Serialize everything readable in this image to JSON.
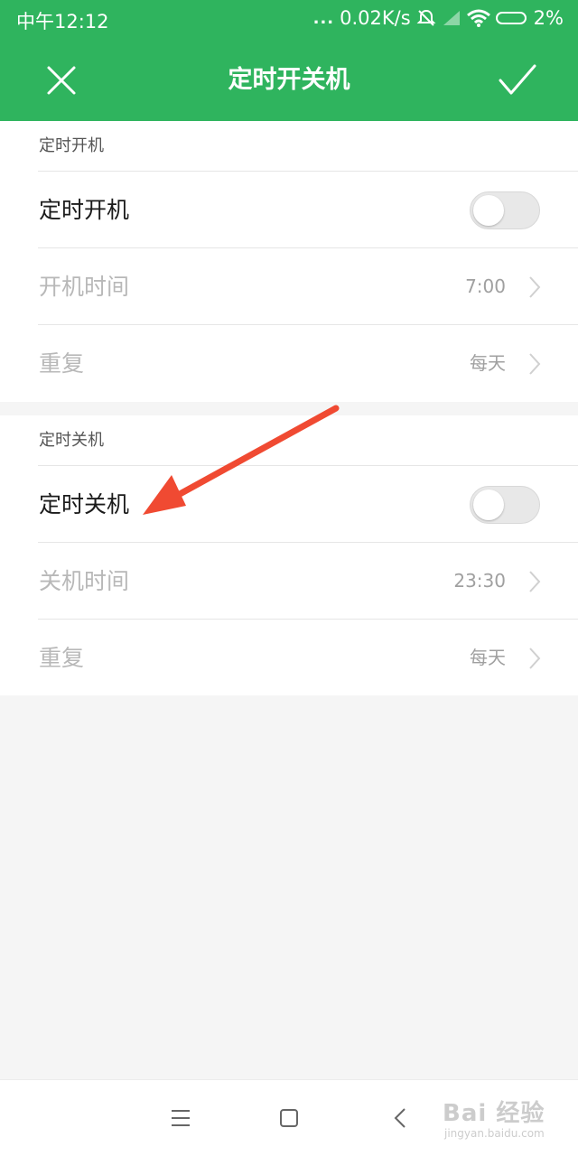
{
  "status_bar": {
    "time": "中午12:12",
    "dots": "...",
    "net_speed": "0.02K/s",
    "battery": "2%"
  },
  "header": {
    "title": "定时开关机",
    "icons": {
      "close": "close-icon",
      "confirm": "check-icon"
    }
  },
  "sections": [
    {
      "title": "定时开机",
      "toggle": {
        "label": "定时开机",
        "enabled": false
      },
      "time": {
        "label": "开机时间",
        "value": "7:00"
      },
      "repeat": {
        "label": "重复",
        "value": "每天"
      }
    },
    {
      "title": "定时关机",
      "toggle": {
        "label": "定时关机",
        "enabled": false
      },
      "time": {
        "label": "关机时间",
        "value": "23:30"
      },
      "repeat": {
        "label": "重复",
        "value": "每天"
      }
    }
  ],
  "nav_bar": {
    "icons": [
      "menu-icon",
      "home-icon",
      "back-icon"
    ]
  },
  "watermark": {
    "brand": "Bai 经验",
    "url": "jingyan.baidu.com"
  },
  "colors": {
    "header": "#2fb45e",
    "annotation_arrow": "#f04a32",
    "background": "#f5f5f5"
  }
}
